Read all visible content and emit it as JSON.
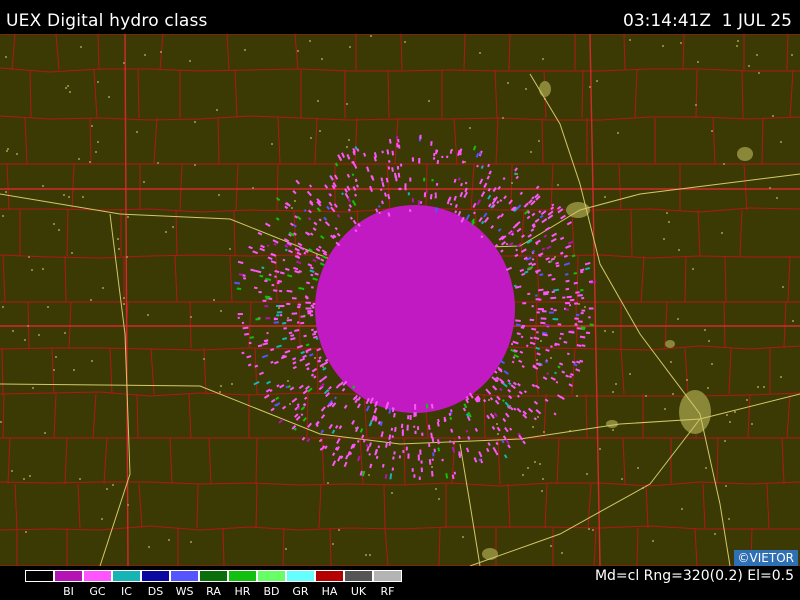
{
  "header": {
    "title": "UEX Digital hydro class",
    "timestamp": "03:14:41Z  1 JUL 25"
  },
  "map": {
    "background_color": "#3c3a04",
    "county_line_color": "#b01818",
    "road_color": "#d2c86a",
    "urban_color": "#8a8838",
    "echo_color": "#c21ac2",
    "credit": "©VIETOR"
  },
  "legend": {
    "items": [
      {
        "label": "",
        "color": "#000000"
      },
      {
        "label": "BI",
        "color": "#b314b3"
      },
      {
        "label": "GC",
        "color": "#ff55ff"
      },
      {
        "label": "IC",
        "color": "#16b4b4"
      },
      {
        "label": "DS",
        "color": "#0a0aa0"
      },
      {
        "label": "WS",
        "color": "#5555ff"
      },
      {
        "label": "RA",
        "color": "#0a6e0a"
      },
      {
        "label": "HR",
        "color": "#12c012"
      },
      {
        "label": "BD",
        "color": "#66ff66"
      },
      {
        "label": "GR",
        "color": "#66ffff"
      },
      {
        "label": "HA",
        "color": "#b40000"
      },
      {
        "label": "UK",
        "color": "#555555"
      },
      {
        "label": "RF",
        "color": "#b4b4b4"
      }
    ]
  },
  "status": {
    "params": "Md=cl Rng=320(0.2) El=0.5"
  }
}
